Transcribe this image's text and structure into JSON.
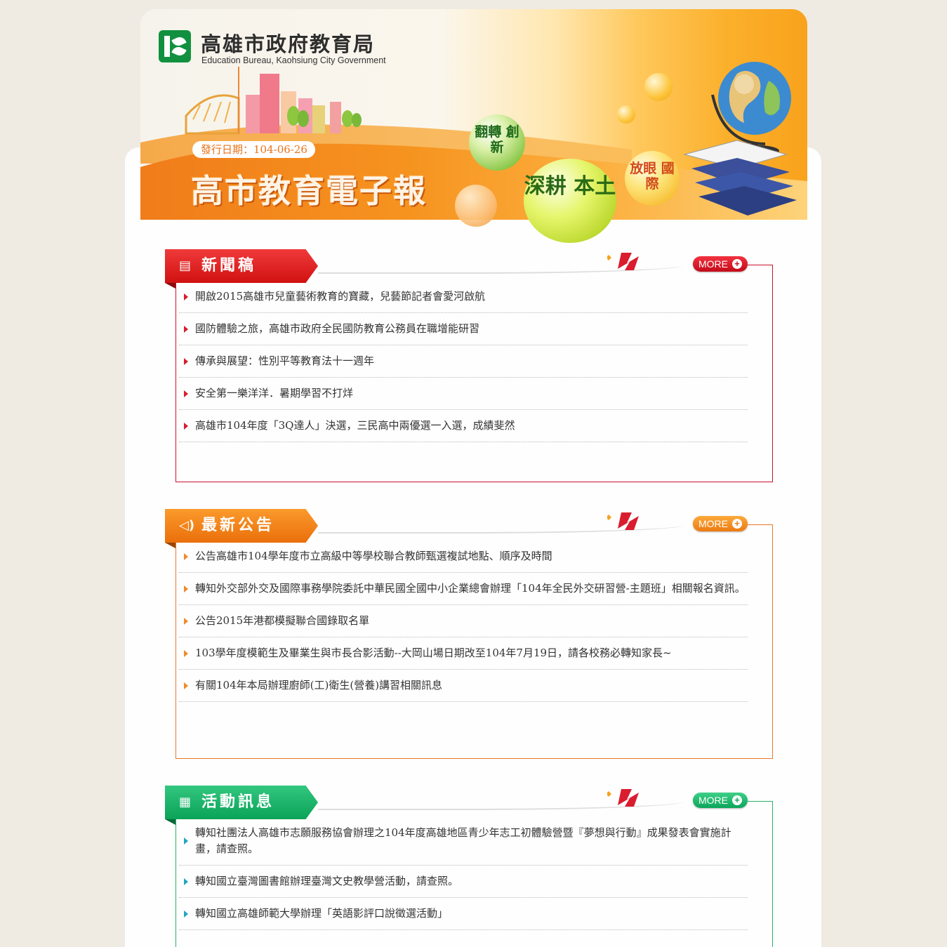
{
  "header": {
    "org_title": "高雄市政府教育局",
    "org_subtitle": "Education Bureau, Kaohsiung City Government",
    "issue_date": "發行日期：104-06-26",
    "banner_title": "高市教育電子報",
    "bubbles": [
      "翻轉 創新",
      "深耕 本土",
      "放眼 國際"
    ]
  },
  "colors": {
    "news": "#d01111",
    "announcements": "#ea6f0a",
    "activities": "#0aa357",
    "page_bg": "#efebe3"
  },
  "sections": {
    "news": {
      "title": "新聞稿",
      "icon": "document-icon",
      "more_label": "MORE",
      "items": [
        "開啟2015高雄市兒童藝術教育的寶藏，兒藝節記者會愛河啟航",
        "國防體驗之旅，高雄市政府全民國防教育公務員在職增能研習",
        "傳承與展望：性別平等教育法十一週年",
        "安全第一樂洋洋．暑期學習不打烊",
        "高雄市104年度「3Q達人」決選，三民高中兩優選一入選，成績斐然"
      ]
    },
    "announcements": {
      "title": "最新公告",
      "icon": "megaphone-icon",
      "more_label": "MORE",
      "items": [
        "公告高雄市104學年度市立高級中等學校聯合教師甄選複試地點、順序及時間",
        "轉知外交部外交及國際事務學院委託中華民國全國中小企業總會辦理「104年全民外交研習營-主題班」相關報名資訊。",
        "公告2015年港都模擬聯合國錄取名單",
        "103學年度模範生及畢業生與市長合影活動--大岡山場日期改至104年7月19日，請各校務必轉知家長~",
        "有關104年本局辦理廚師(工)衛生(營養)講習相關訊息"
      ]
    },
    "activities": {
      "title": "活動訊息",
      "icon": "calendar-icon",
      "more_label": "MORE",
      "items": [
        "轉知社團法人高雄市志願服務協會辦理之104年度高雄地區青少年志工初體驗營暨『夢想與行動』成果發表會實施計畫，請查照。",
        "轉知國立臺灣圖書館辦理臺灣文史教學營活動，請查照。",
        "轉知國立高雄師範大學辦理「英語影評口說徵選活動」"
      ]
    }
  }
}
